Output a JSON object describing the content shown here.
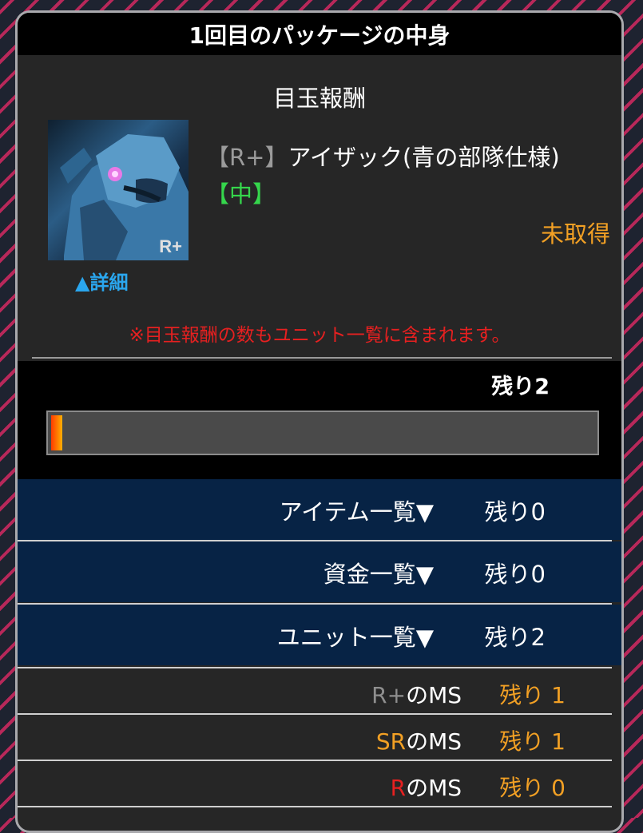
{
  "header": {
    "title": "1回目のパッケージの中身"
  },
  "reward": {
    "section_title": "目玉報酬",
    "rank_tag": "【R+】",
    "name": "アイザック(青の部隊仕様)",
    "size_tag": "【中】",
    "thumb_badge": "R+",
    "status": "未取得",
    "detail_link": "▲詳細",
    "notice": "※目玉報酬の数もユニット一覧に含まれます。"
  },
  "progress": {
    "remaining_label": "残り2",
    "fill_fraction": 0.02
  },
  "categories": [
    {
      "label": "アイテム一覧▼",
      "remaining": "残り0"
    },
    {
      "label": "資金一覧▼",
      "remaining": "残り0"
    },
    {
      "label": "ユニット一覧▼",
      "remaining": "残り2"
    }
  ],
  "ms_rows": [
    {
      "rank": "R+",
      "rank_color": "#8f8f8f",
      "suffix": "のMS",
      "remaining": "残り 1"
    },
    {
      "rank": "SR",
      "rank_color": "#f2a024",
      "suffix": "のMS",
      "remaining": "残り 1"
    },
    {
      "rank": "R",
      "rank_color": "#e62020",
      "suffix": "のMS",
      "remaining": "残り 0"
    }
  ],
  "colors": {
    "accent_orange": "#f2a024",
    "link_blue": "#2aa6ee",
    "notice_red": "#e62020",
    "size_green": "#35d64c",
    "category_bg": "#072345"
  }
}
